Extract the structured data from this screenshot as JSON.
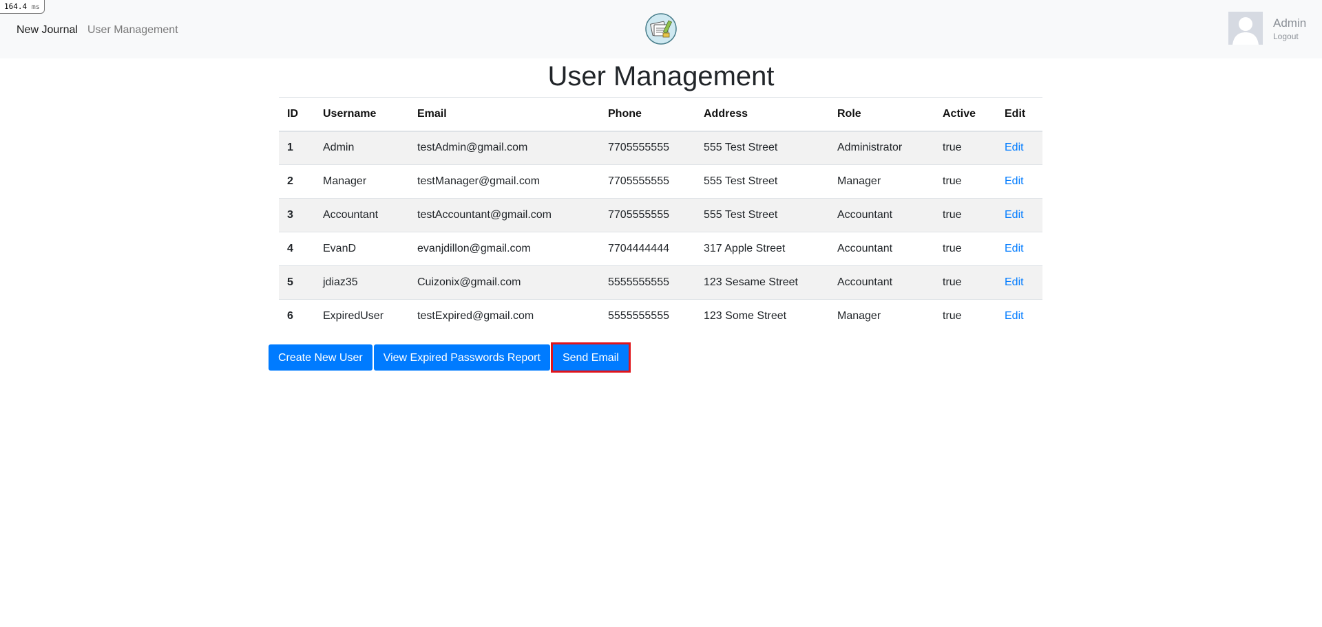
{
  "perf": {
    "value": "164.4",
    "unit": "ms"
  },
  "navbar": {
    "brand_label": "New Journal",
    "users_link_label": "User Management",
    "logo_icon": "journal-logo-icon",
    "user": {
      "name": "Admin",
      "logout_label": "Logout",
      "avatar_icon": "avatar-placeholder-icon"
    }
  },
  "page": {
    "title": "User Management"
  },
  "table": {
    "columns": [
      "ID",
      "Username",
      "Email",
      "Phone",
      "Address",
      "Role",
      "Active",
      "Edit"
    ],
    "rows": [
      {
        "id": "1",
        "username": "Admin",
        "email": "testAdmin@gmail.com",
        "phone": "7705555555",
        "address": "555 Test Street",
        "role": "Administrator",
        "active": "true",
        "edit": "Edit"
      },
      {
        "id": "2",
        "username": "Manager",
        "email": "testManager@gmail.com",
        "phone": "7705555555",
        "address": "555 Test Street",
        "role": "Manager",
        "active": "true",
        "edit": "Edit"
      },
      {
        "id": "3",
        "username": "Accountant",
        "email": "testAccountant@gmail.com",
        "phone": "7705555555",
        "address": "555 Test Street",
        "role": "Accountant",
        "active": "true",
        "edit": "Edit"
      },
      {
        "id": "4",
        "username": "EvanD",
        "email": "evanjdillon@gmail.com",
        "phone": "7704444444",
        "address": "317 Apple Street",
        "role": "Accountant",
        "active": "true",
        "edit": "Edit"
      },
      {
        "id": "5",
        "username": "jdiaz35",
        "email": "Cuizonix@gmail.com",
        "phone": "5555555555",
        "address": "123 Sesame Street",
        "role": "Accountant",
        "active": "true",
        "edit": "Edit"
      },
      {
        "id": "6",
        "username": "ExpiredUser",
        "email": "testExpired@gmail.com",
        "phone": "5555555555",
        "address": "123 Some Street",
        "role": "Manager",
        "active": "true",
        "edit": "Edit"
      }
    ]
  },
  "actions": {
    "create_label": "Create New User",
    "report_label": "View Expired Passwords Report",
    "email_label": "Send Email"
  },
  "colors": {
    "primary": "#007bff",
    "highlight": "#e0141b",
    "navbar_bg": "#f8f9fa",
    "stripe": "#f2f2f2"
  }
}
